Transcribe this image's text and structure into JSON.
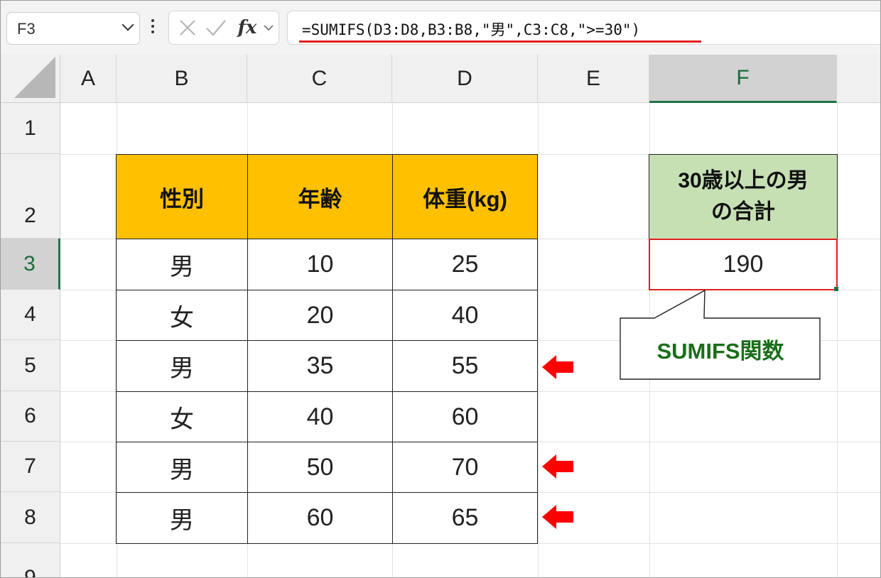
{
  "namebox": {
    "value": "F3"
  },
  "formula_bar": {
    "formula": "=SUMIFS(D3:D8,B3:B8,\"男\",C3:C8,\">=30\")"
  },
  "icons": {
    "cancel": "x-icon",
    "enter": "check-icon",
    "function": "fx-icon"
  },
  "columns": [
    "A",
    "B",
    "C",
    "D",
    "E",
    "F"
  ],
  "rows": [
    "1",
    "2",
    "3",
    "4",
    "5",
    "6",
    "7",
    "8",
    "9"
  ],
  "table": {
    "headers": [
      "性別",
      "年齢",
      "体重(kg)"
    ],
    "rows": [
      [
        "男",
        "10",
        "25"
      ],
      [
        "女",
        "20",
        "40"
      ],
      [
        "男",
        "35",
        "55"
      ],
      [
        "女",
        "40",
        "60"
      ],
      [
        "男",
        "50",
        "70"
      ],
      [
        "男",
        "60",
        "65"
      ]
    ]
  },
  "summary": {
    "label_line1": "30歳以上の男",
    "label_line2": "の合計",
    "value": "190"
  },
  "callout": {
    "text": "SUMIFS関数"
  },
  "colors": {
    "header_fill": "#ffc000",
    "summary_fill": "#c6e0b4",
    "highlight": "#e02020",
    "callout_text": "#1a6e1a",
    "selection": "#217346"
  }
}
